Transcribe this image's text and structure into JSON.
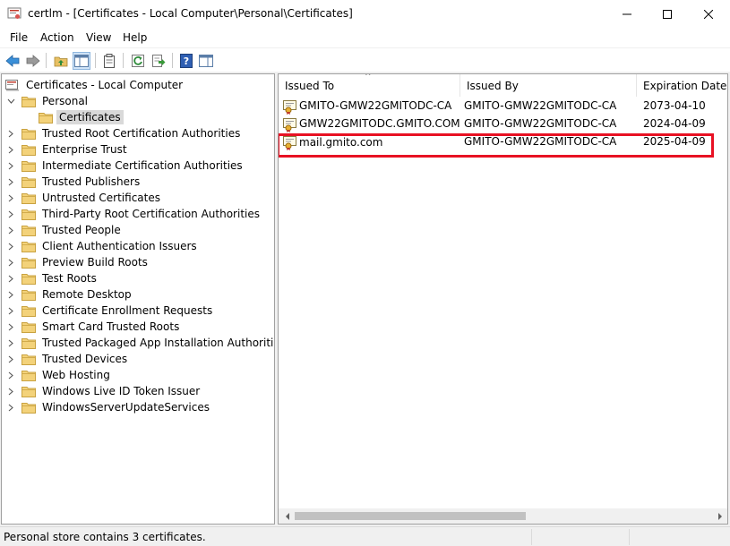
{
  "window": {
    "title": "certlm - [Certificates - Local Computer\\Personal\\Certificates]"
  },
  "menu": [
    "File",
    "Action",
    "View",
    "Help"
  ],
  "toolbar": {
    "icons": [
      "back-icon",
      "forward-icon",
      "up-folder-icon",
      "show-hide-console-tree-icon",
      "properties-icon",
      "refresh-icon",
      "export-list-icon",
      "help-icon",
      "show-action-pane-icon"
    ]
  },
  "tree": {
    "root": "Certificates - Local Computer",
    "items": [
      {
        "label": "Personal",
        "expanded": true
      },
      {
        "label": "Certificates",
        "selected": true
      },
      {
        "label": "Trusted Root Certification Authorities"
      },
      {
        "label": "Enterprise Trust"
      },
      {
        "label": "Intermediate Certification Authorities"
      },
      {
        "label": "Trusted Publishers"
      },
      {
        "label": "Untrusted Certificates"
      },
      {
        "label": "Third-Party Root Certification Authorities"
      },
      {
        "label": "Trusted People"
      },
      {
        "label": "Client Authentication Issuers"
      },
      {
        "label": "Preview Build Roots"
      },
      {
        "label": "Test Roots"
      },
      {
        "label": "Remote Desktop"
      },
      {
        "label": "Certificate Enrollment Requests"
      },
      {
        "label": "Smart Card Trusted Roots"
      },
      {
        "label": "Trusted Packaged App Installation Authorities"
      },
      {
        "label": "Trusted Devices"
      },
      {
        "label": "Web Hosting"
      },
      {
        "label": "Windows Live ID Token Issuer"
      },
      {
        "label": "WindowsServerUpdateServices"
      }
    ]
  },
  "list": {
    "columns": [
      "Issued To",
      "Issued By",
      "Expiration Date"
    ],
    "rows": [
      {
        "issued_to": "GMITO-GMW22GMITODC-CA",
        "issued_by": "GMITO-GMW22GMITODC-CA",
        "expiration": "2073-04-10"
      },
      {
        "issued_to": "GMW22GMITODC.GMITO.COM",
        "issued_by": "GMITO-GMW22GMITODC-CA",
        "expiration": "2024-04-09"
      },
      {
        "issued_to": "mail.gmito.com",
        "issued_by": "GMITO-GMW22GMITODC-CA",
        "expiration": "2025-04-09",
        "highlighted": true
      }
    ]
  },
  "status": {
    "text": "Personal store contains 3 certificates."
  },
  "colors": {
    "highlight_border": "#e81123",
    "selection": "#d9d9d9",
    "folder": "#e8c064"
  }
}
